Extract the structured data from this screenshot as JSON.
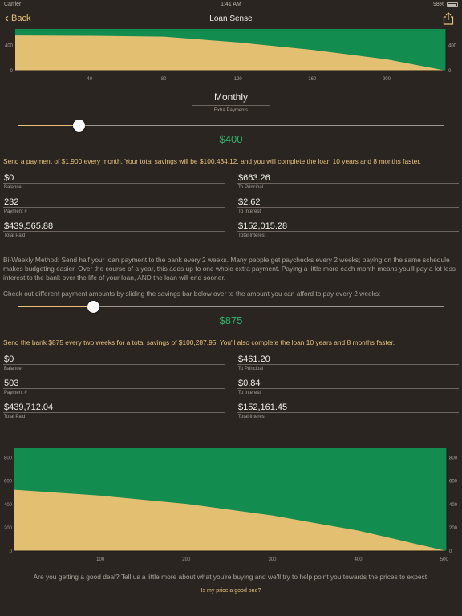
{
  "status_bar": {
    "carrier": "Carrier",
    "time": "1:41 AM",
    "battery": "98%"
  },
  "nav": {
    "back_label": "Back",
    "title": "Loan Sense"
  },
  "colors": {
    "accent": "#e6c27a",
    "green": "#2eb06a",
    "principal_fill": "#e3bf72",
    "interest_fill": "#138c4f",
    "background": "#2b2521"
  },
  "chart_data": [
    {
      "type": "area",
      "title": "",
      "y_tick_labels": [
        "0",
        "400"
      ],
      "x_tick_labels": [
        "40",
        "80",
        "120",
        "160",
        "200"
      ],
      "x": [
        0,
        40,
        80,
        120,
        160,
        200,
        232
      ],
      "series": [
        {
          "values": [
            560,
            555,
            540,
            450,
            330,
            180,
            0
          ]
        }
      ],
      "ylim": [
        0,
        663
      ],
      "xlim": [
        0,
        232
      ],
      "grid": false
    },
    {
      "type": "area",
      "title": "",
      "y_tick_labels": [
        "0",
        "200",
        "400",
        "600",
        "800"
      ],
      "x_tick_labels": [
        "100",
        "200",
        "300",
        "400",
        "500"
      ],
      "x": [
        0,
        100,
        200,
        300,
        400,
        503
      ],
      "series": [
        {
          "values": [
            525,
            475,
            405,
            305,
            175,
            0
          ]
        }
      ],
      "ylim": [
        0,
        880
      ],
      "xlim": [
        0,
        503
      ],
      "grid": false
    }
  ],
  "monthly": {
    "mode_label": "Monthly",
    "mode_sublabel": "Extra Payments",
    "slider_fraction": 0.142,
    "amount": "$400",
    "summary": "Send a payment of $1,900 every month. Your total savings will be $100,434.12, and you will complete the loan 10 years and 8 months faster.",
    "fields": {
      "balance": {
        "value": "$0",
        "label": "Balance"
      },
      "payment_number": {
        "value": "232",
        "label": "Payment #"
      },
      "total_paid": {
        "value": "$439,565.88",
        "label": "Total Paid"
      },
      "to_principal": {
        "value": "$663.26",
        "label": "To Principal"
      },
      "to_interest": {
        "value": "$2.62",
        "label": "To Interest"
      },
      "total_interest": {
        "value": "$152,015.28",
        "label": "Total Interest"
      }
    }
  },
  "biweekly": {
    "intro": "Bi-Weekly Method: Send half your loan payment to the bank every 2 weeks. Many people get paychecks every 2 weeks; paying on the same schedule makes budgeting easier. Over the course of a year, this adds up to one whole extra payment. Paying a little more each month means you'll pay a lot less interest to the bank over the life of your loan, AND the loan will end sooner.",
    "prompt": "Check out different payment amounts by sliding the savings bar below over to the amount you can afford to pay every 2 weeks:",
    "slider_fraction": 0.176,
    "amount": "$875",
    "summary": "Send the bank $875 every two weeks for a total savings of $100,287.95. You'll also complete the loan 10 years and 8 months faster.",
    "fields": {
      "balance": {
        "value": "$0",
        "label": "Balance"
      },
      "payment_number": {
        "value": "503",
        "label": "Payment #"
      },
      "total_paid": {
        "value": "$439,712.04",
        "label": "Total Paid"
      },
      "to_principal": {
        "value": "$461.20",
        "label": "To Principal"
      },
      "to_interest": {
        "value": "$0.84",
        "label": "To Interest"
      },
      "total_interest": {
        "value": "$152,161.45",
        "label": "Total Interest"
      }
    }
  },
  "footer": {
    "question": "Are you getting a good deal? Tell us a little more about what you're buying and we'll try to help point you towards the prices to expect.",
    "link": "Is my price a good one?"
  }
}
